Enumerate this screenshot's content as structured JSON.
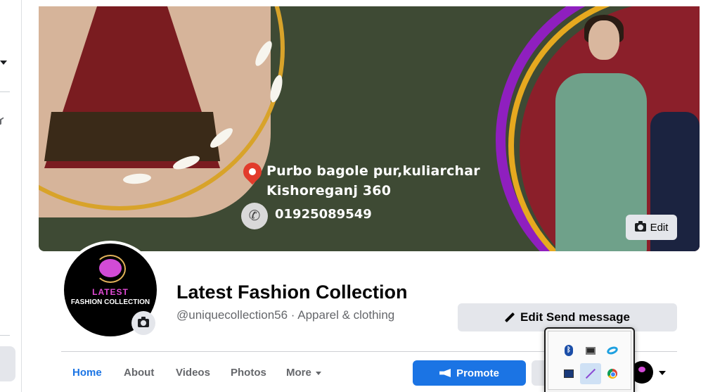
{
  "cover": {
    "address_line1": "Purbo bagole pur,kuliarchar",
    "address_line2": "Kishoreganj 360",
    "phone": "01925089549",
    "edit_label": "Edit"
  },
  "profile": {
    "logo_line1": "LATEST",
    "logo_line2": "FASHION COLLECTION",
    "name": "Latest Fashion Collection",
    "subtitle": "@uniquecollection56 · Apparel & clothing"
  },
  "actions": {
    "edit_send_message": "Edit Send message",
    "promote": "Promote"
  },
  "tabs": [
    {
      "label": "Home",
      "active": true
    },
    {
      "label": "About"
    },
    {
      "label": "Videos"
    },
    {
      "label": "Photos"
    },
    {
      "label": "More"
    }
  ],
  "tray_icons": [
    "bluetooth-icon",
    "monitor-icon",
    "swirl-app-icon",
    "display-icon",
    "pen-icon",
    "chrome-icon"
  ],
  "colors": {
    "accent": "#1b74e4",
    "cover_green": "#3e4a34",
    "maroon": "#8b1f2a",
    "purple": "#8f1fbf",
    "gold": "#e6a91f"
  }
}
